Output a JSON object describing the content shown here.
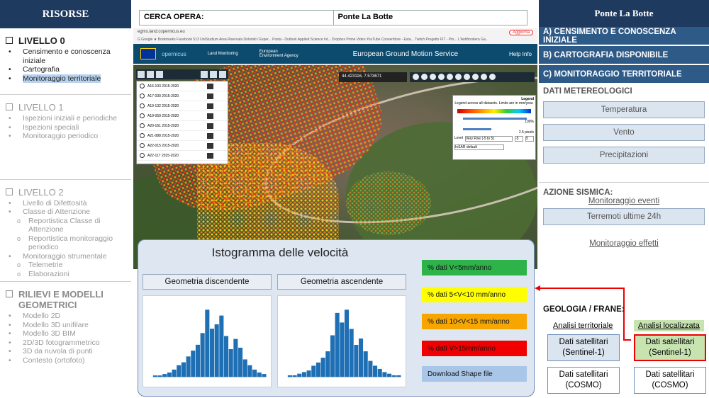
{
  "left": {
    "header": "RISORSE",
    "levels": [
      {
        "title": "LIVELLO 0",
        "items": [
          "Censimento e conoscenza iniziale",
          "Cartografia",
          "Monitoraggio territoriale"
        ]
      },
      {
        "title": "LIVELLO 1",
        "items": [
          "Ispezioni iniziali e periodiche",
          "Ispezioni speciali",
          "Monitoraggio periodico"
        ]
      },
      {
        "title": "LIVELLO 2",
        "items": [
          "Livello di Difettosità",
          "Classe di Attenzione",
          "Reportistica Classe di Attenzione",
          "Reportistica monitoraggio periodico",
          "Monitoraggio strumentale",
          "Telemetrie",
          "Elaborazioni"
        ]
      },
      {
        "title": "RILIEVI E MODELLI GEOMETRICI",
        "items": [
          "Modello 2D",
          "Modello 3D unifilare",
          "Modello 3D BIM",
          "2D/3D fotogrammetrico",
          "3D da nuvola di punti",
          "Contesto (ortofoto)"
        ]
      }
    ]
  },
  "search": {
    "label": "CERCA OPERA:",
    "value": "Ponte La Botte"
  },
  "browser": {
    "url": "egms.land.copernicus.eu",
    "update_button": "Aggiorna",
    "bookmarks": "G Google  ★ Bookmarks  Facebook  513  UniStudium  Area Riservata  Dolomiti / Esper...  Posta - Outlook  Applied Science Int...  Dropbox  Prime Video  YouTube  Convertitore - Esta...  Twitch  Progetto FIT - Pro...  L'Antifrontiera Ga...",
    "brand": "opernicus",
    "land_monitoring": "Land Monitoring",
    "eea": "European Environment Agency",
    "site_title": "European Ground Motion Service",
    "help": "Help  Info"
  },
  "map": {
    "coords": "44.423116, 7.573671",
    "datasets": [
      {
        "name": "A16-103",
        "years": "2015-2020"
      },
      {
        "name": "A17-030",
        "years": "2015-2020"
      },
      {
        "name": "A19-132",
        "years": "2015-2020"
      },
      {
        "name": "A19-059",
        "years": "2015-2020"
      },
      {
        "name": "A20-161",
        "years": "2015-2020"
      },
      {
        "name": "A21-088",
        "years": "2015-2020"
      },
      {
        "name": "A22-015",
        "years": "2015-2020"
      },
      {
        "name": "A22-117",
        "years": "2015-2020"
      }
    ],
    "legend": {
      "title": "Legend",
      "subtitle": "Legend across all datasets. Limits are in mm/year.",
      "opacity": "100%",
      "size": "2.5 pixels",
      "level_label": "Level",
      "level_value": "Very Fine (-5 to 5)",
      "level_min": "-5",
      "level_max": "5",
      "style": "InSAR default"
    }
  },
  "histogram_panel": {
    "title": "Istogramma delle velocità",
    "desc_button": "Geometria discendente",
    "asc_button": "Geometria ascendente",
    "pct_labels": [
      "% dati V<5mm/anno",
      "% dati 5<V<10 mm/anno",
      "% dati 10<V<15 mm/anno",
      "% dati V>15mm/anno"
    ],
    "download": "Download Shape file",
    "colors": {
      "green": "#2eb24a",
      "yellow": "#ffff00",
      "orange": "#f7a600",
      "red": "#f00000",
      "download": "#a9c6e8"
    }
  },
  "chart_data": [
    {
      "type": "bar",
      "title": "Geometria discendente",
      "values": [
        1,
        1,
        2,
        3,
        5,
        8,
        10,
        14,
        18,
        22,
        30,
        46,
        33,
        36,
        42,
        28,
        19,
        26,
        20,
        12,
        8,
        5,
        3,
        2
      ]
    },
    {
      "type": "bar",
      "title": "Geometria ascendente",
      "values": [
        1,
        1,
        2,
        3,
        4,
        7,
        9,
        12,
        16,
        26,
        40,
        34,
        42,
        30,
        20,
        24,
        16,
        10,
        7,
        5,
        3,
        2,
        1,
        1
      ]
    }
  ],
  "right": {
    "header": "Ponte La Botte",
    "sections": [
      "A) CENSIMENTO E CONOSCENZA INIZIALE",
      "B) CARTOGRAFIA DISPONIBILE",
      "C) MONITORAGGIO TERRITORIALE"
    ],
    "meteo_title": "DATI METEREOLOGICI",
    "meteo_buttons": [
      "Temperatura",
      "Vento",
      "Precipitazioni"
    ],
    "seismic_title": "AZIONE SISMICA:",
    "monitor_events": "Monitoraggio eventi",
    "earthquakes": "Terremoti ultime 24h",
    "monitor_effects": "Monitoraggio effetti",
    "geo_title": "GEOLOGIA / FRANE:",
    "analysis_territorial": "Analisi territoriale",
    "analysis_local": "Analisi localizzata",
    "sat_sentinel": "Dati satellitari (Sentinel-1)",
    "sat_cosmo": "Dati satellitari (COSMO)"
  }
}
